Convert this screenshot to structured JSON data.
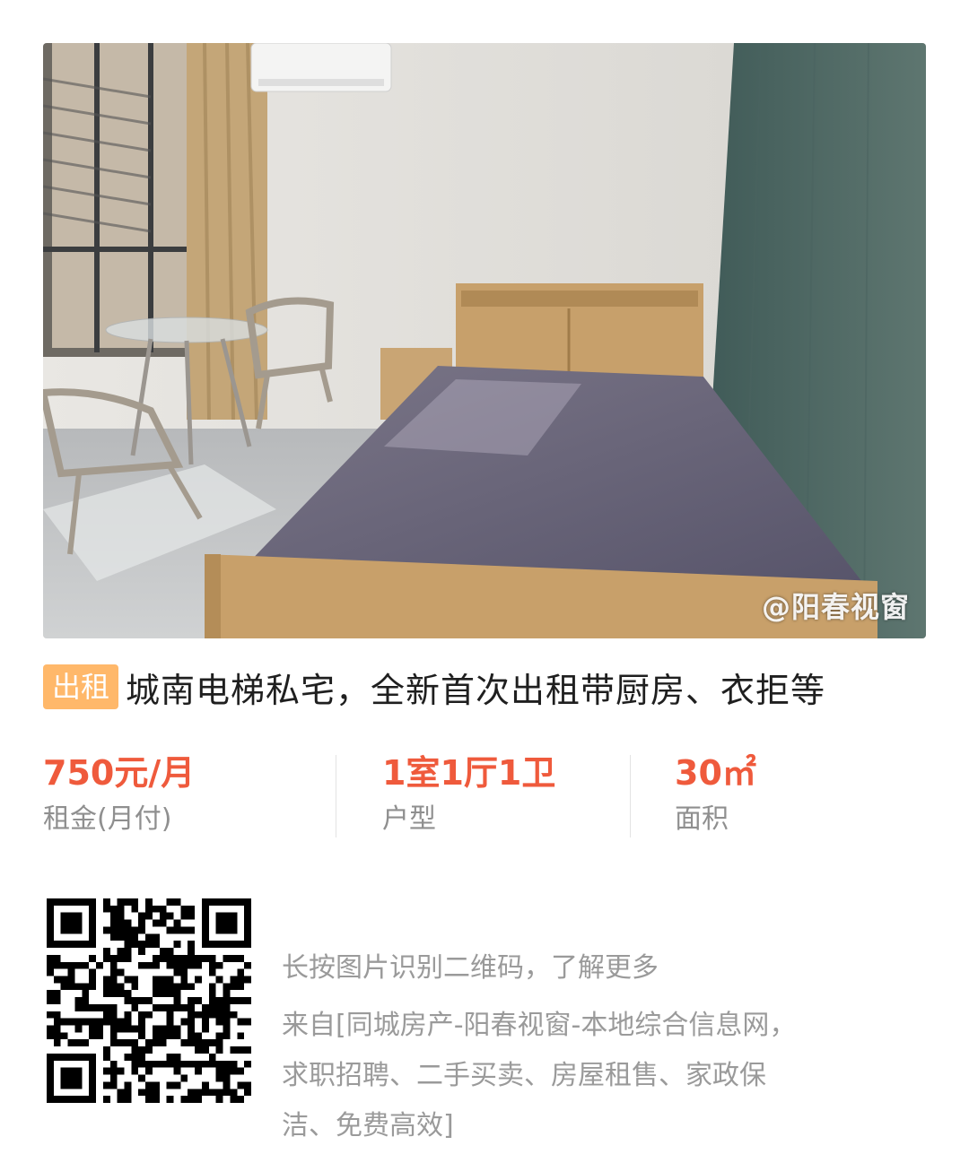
{
  "photo": {
    "watermark": "@阳春视窗"
  },
  "listing": {
    "tag": "出租",
    "title": "城南电梯私宅，全新首次出租带厨房、衣拒等"
  },
  "stats": [
    {
      "value": "750元/月",
      "label": "租金(月付)"
    },
    {
      "value": "1室1厅1卫",
      "label": "户型"
    },
    {
      "value": "30㎡",
      "label": "面积"
    }
  ],
  "qr_section": {
    "hint": "长按图片识别二维码，了解更多",
    "source_lines": [
      "来自[同城房产-阳春视窗-本地综合信息网，",
      "求职招聘、二手买卖、房屋租售、家政保",
      "洁、免费高效]"
    ]
  },
  "colors": {
    "accent": "#ef5a3c",
    "tag_bg": "#ffb86a",
    "muted_text": "#9a9a9a"
  }
}
